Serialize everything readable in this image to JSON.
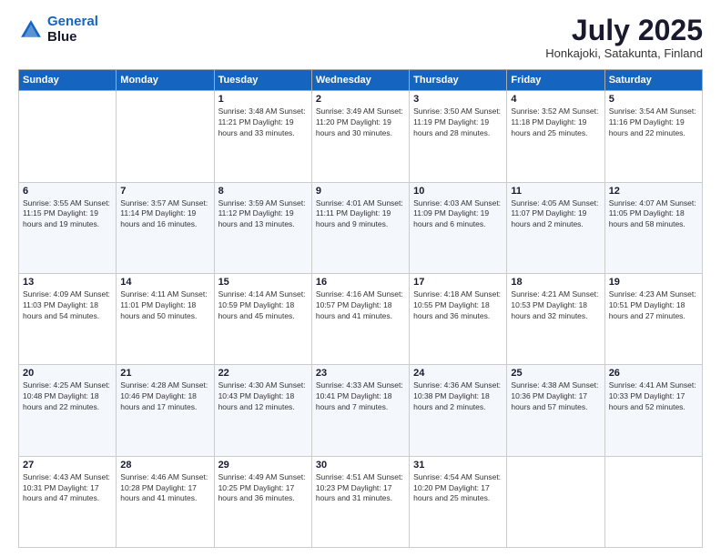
{
  "header": {
    "logo_line1": "General",
    "logo_line2": "Blue",
    "month": "July 2025",
    "location": "Honkajoki, Satakunta, Finland"
  },
  "weekdays": [
    "Sunday",
    "Monday",
    "Tuesday",
    "Wednesday",
    "Thursday",
    "Friday",
    "Saturday"
  ],
  "weeks": [
    [
      {
        "day": "",
        "info": ""
      },
      {
        "day": "",
        "info": ""
      },
      {
        "day": "1",
        "info": "Sunrise: 3:48 AM\nSunset: 11:21 PM\nDaylight: 19 hours and 33 minutes."
      },
      {
        "day": "2",
        "info": "Sunrise: 3:49 AM\nSunset: 11:20 PM\nDaylight: 19 hours and 30 minutes."
      },
      {
        "day": "3",
        "info": "Sunrise: 3:50 AM\nSunset: 11:19 PM\nDaylight: 19 hours and 28 minutes."
      },
      {
        "day": "4",
        "info": "Sunrise: 3:52 AM\nSunset: 11:18 PM\nDaylight: 19 hours and 25 minutes."
      },
      {
        "day": "5",
        "info": "Sunrise: 3:54 AM\nSunset: 11:16 PM\nDaylight: 19 hours and 22 minutes."
      }
    ],
    [
      {
        "day": "6",
        "info": "Sunrise: 3:55 AM\nSunset: 11:15 PM\nDaylight: 19 hours and 19 minutes."
      },
      {
        "day": "7",
        "info": "Sunrise: 3:57 AM\nSunset: 11:14 PM\nDaylight: 19 hours and 16 minutes."
      },
      {
        "day": "8",
        "info": "Sunrise: 3:59 AM\nSunset: 11:12 PM\nDaylight: 19 hours and 13 minutes."
      },
      {
        "day": "9",
        "info": "Sunrise: 4:01 AM\nSunset: 11:11 PM\nDaylight: 19 hours and 9 minutes."
      },
      {
        "day": "10",
        "info": "Sunrise: 4:03 AM\nSunset: 11:09 PM\nDaylight: 19 hours and 6 minutes."
      },
      {
        "day": "11",
        "info": "Sunrise: 4:05 AM\nSunset: 11:07 PM\nDaylight: 19 hours and 2 minutes."
      },
      {
        "day": "12",
        "info": "Sunrise: 4:07 AM\nSunset: 11:05 PM\nDaylight: 18 hours and 58 minutes."
      }
    ],
    [
      {
        "day": "13",
        "info": "Sunrise: 4:09 AM\nSunset: 11:03 PM\nDaylight: 18 hours and 54 minutes."
      },
      {
        "day": "14",
        "info": "Sunrise: 4:11 AM\nSunset: 11:01 PM\nDaylight: 18 hours and 50 minutes."
      },
      {
        "day": "15",
        "info": "Sunrise: 4:14 AM\nSunset: 10:59 PM\nDaylight: 18 hours and 45 minutes."
      },
      {
        "day": "16",
        "info": "Sunrise: 4:16 AM\nSunset: 10:57 PM\nDaylight: 18 hours and 41 minutes."
      },
      {
        "day": "17",
        "info": "Sunrise: 4:18 AM\nSunset: 10:55 PM\nDaylight: 18 hours and 36 minutes."
      },
      {
        "day": "18",
        "info": "Sunrise: 4:21 AM\nSunset: 10:53 PM\nDaylight: 18 hours and 32 minutes."
      },
      {
        "day": "19",
        "info": "Sunrise: 4:23 AM\nSunset: 10:51 PM\nDaylight: 18 hours and 27 minutes."
      }
    ],
    [
      {
        "day": "20",
        "info": "Sunrise: 4:25 AM\nSunset: 10:48 PM\nDaylight: 18 hours and 22 minutes."
      },
      {
        "day": "21",
        "info": "Sunrise: 4:28 AM\nSunset: 10:46 PM\nDaylight: 18 hours and 17 minutes."
      },
      {
        "day": "22",
        "info": "Sunrise: 4:30 AM\nSunset: 10:43 PM\nDaylight: 18 hours and 12 minutes."
      },
      {
        "day": "23",
        "info": "Sunrise: 4:33 AM\nSunset: 10:41 PM\nDaylight: 18 hours and 7 minutes."
      },
      {
        "day": "24",
        "info": "Sunrise: 4:36 AM\nSunset: 10:38 PM\nDaylight: 18 hours and 2 minutes."
      },
      {
        "day": "25",
        "info": "Sunrise: 4:38 AM\nSunset: 10:36 PM\nDaylight: 17 hours and 57 minutes."
      },
      {
        "day": "26",
        "info": "Sunrise: 4:41 AM\nSunset: 10:33 PM\nDaylight: 17 hours and 52 minutes."
      }
    ],
    [
      {
        "day": "27",
        "info": "Sunrise: 4:43 AM\nSunset: 10:31 PM\nDaylight: 17 hours and 47 minutes."
      },
      {
        "day": "28",
        "info": "Sunrise: 4:46 AM\nSunset: 10:28 PM\nDaylight: 17 hours and 41 minutes."
      },
      {
        "day": "29",
        "info": "Sunrise: 4:49 AM\nSunset: 10:25 PM\nDaylight: 17 hours and 36 minutes."
      },
      {
        "day": "30",
        "info": "Sunrise: 4:51 AM\nSunset: 10:23 PM\nDaylight: 17 hours and 31 minutes."
      },
      {
        "day": "31",
        "info": "Sunrise: 4:54 AM\nSunset: 10:20 PM\nDaylight: 17 hours and 25 minutes."
      },
      {
        "day": "",
        "info": ""
      },
      {
        "day": "",
        "info": ""
      }
    ]
  ]
}
